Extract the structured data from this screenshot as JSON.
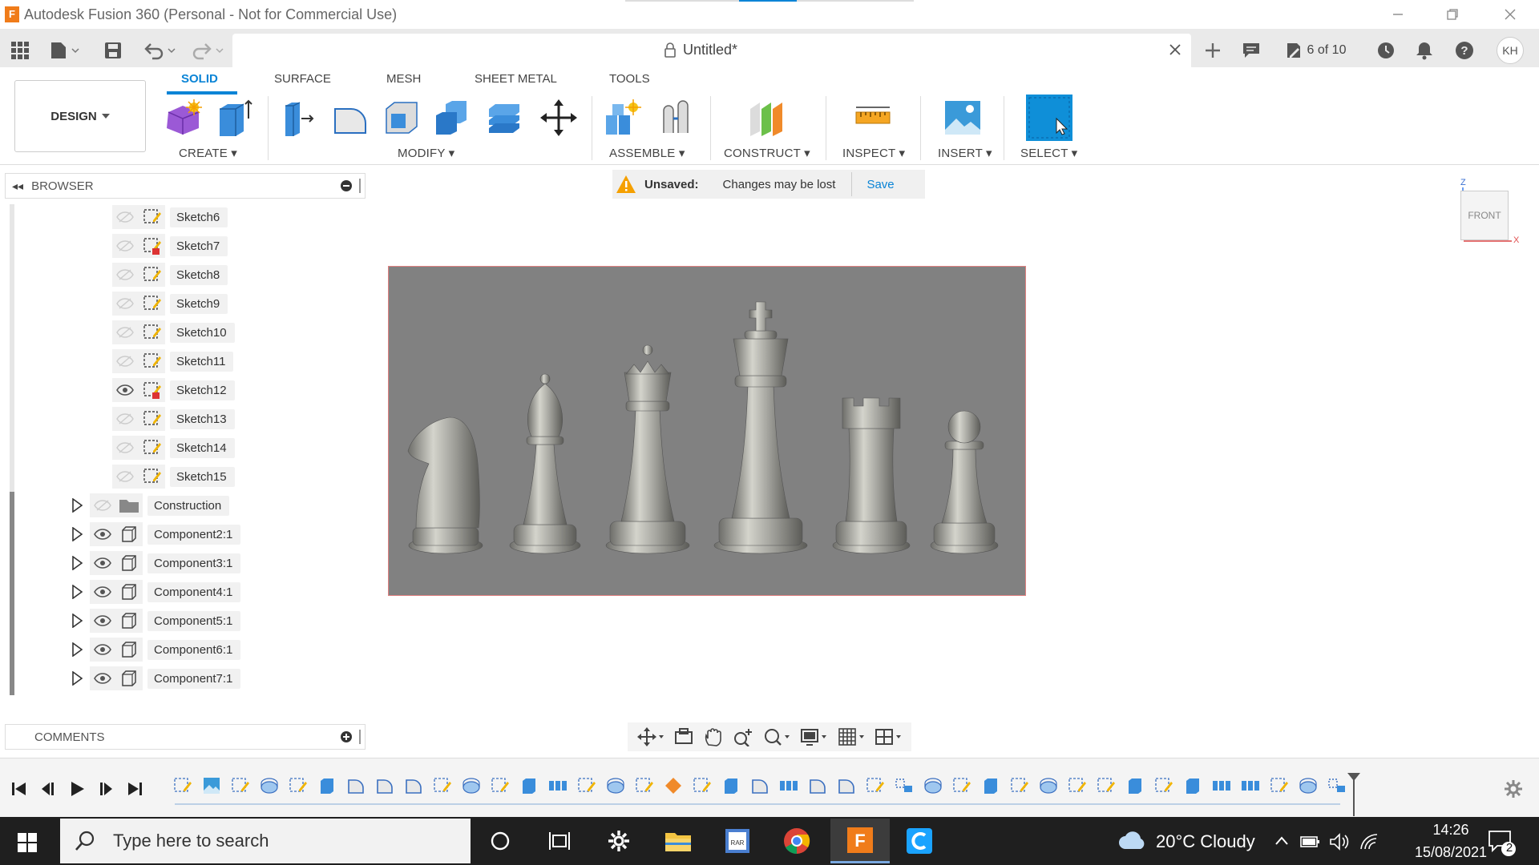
{
  "app": {
    "title": "Autodesk Fusion 360 (Personal - Not for Commercial Use)",
    "document_title": "Untitled*",
    "jobs_status": "6 of 10",
    "user_initials": "KH"
  },
  "ribbon": {
    "workspace": "DESIGN",
    "tabs": [
      {
        "label": "SOLID",
        "active": true
      },
      {
        "label": "SURFACE"
      },
      {
        "label": "MESH"
      },
      {
        "label": "SHEET METAL"
      },
      {
        "label": "TOOLS"
      }
    ],
    "groups": [
      "CREATE",
      "MODIFY",
      "ASSEMBLE",
      "CONSTRUCT",
      "INSPECT",
      "INSERT",
      "SELECT"
    ]
  },
  "browser": {
    "title": "BROWSER",
    "sketches": [
      {
        "label": "Sketch6",
        "visible": false
      },
      {
        "label": "Sketch7",
        "visible": false
      },
      {
        "label": "Sketch8",
        "visible": false
      },
      {
        "label": "Sketch9",
        "visible": false
      },
      {
        "label": "Sketch10",
        "visible": false
      },
      {
        "label": "Sketch11",
        "visible": false
      },
      {
        "label": "Sketch12",
        "visible": true
      },
      {
        "label": "Sketch13",
        "visible": false
      },
      {
        "label": "Sketch14",
        "visible": false
      },
      {
        "label": "Sketch15",
        "visible": false
      }
    ],
    "folders": [
      {
        "label": "Construction",
        "visible": false
      },
      {
        "label": "Component2:1",
        "visible": true
      },
      {
        "label": "Component3:1",
        "visible": true
      },
      {
        "label": "Component4:1",
        "visible": true
      },
      {
        "label": "Component5:1",
        "visible": true
      },
      {
        "label": "Component6:1",
        "visible": true
      },
      {
        "label": "Component7:1",
        "visible": true
      }
    ]
  },
  "unsaved": {
    "label": "Unsaved:",
    "message": "Changes may be lost",
    "save": "Save"
  },
  "viewcube": {
    "face": "FRONT",
    "axis_z": "Z",
    "axis_x": "X"
  },
  "comments": {
    "title": "COMMENTS"
  },
  "taskbar": {
    "search_placeholder": "Type here to search",
    "weather": "20°C  Cloudy",
    "time": "14:26",
    "date": "15/08/2021",
    "notifications": "2"
  },
  "colors": {
    "accent": "#0a84d6",
    "viewport": "#818181",
    "taskbar": "#1f1f1f"
  }
}
